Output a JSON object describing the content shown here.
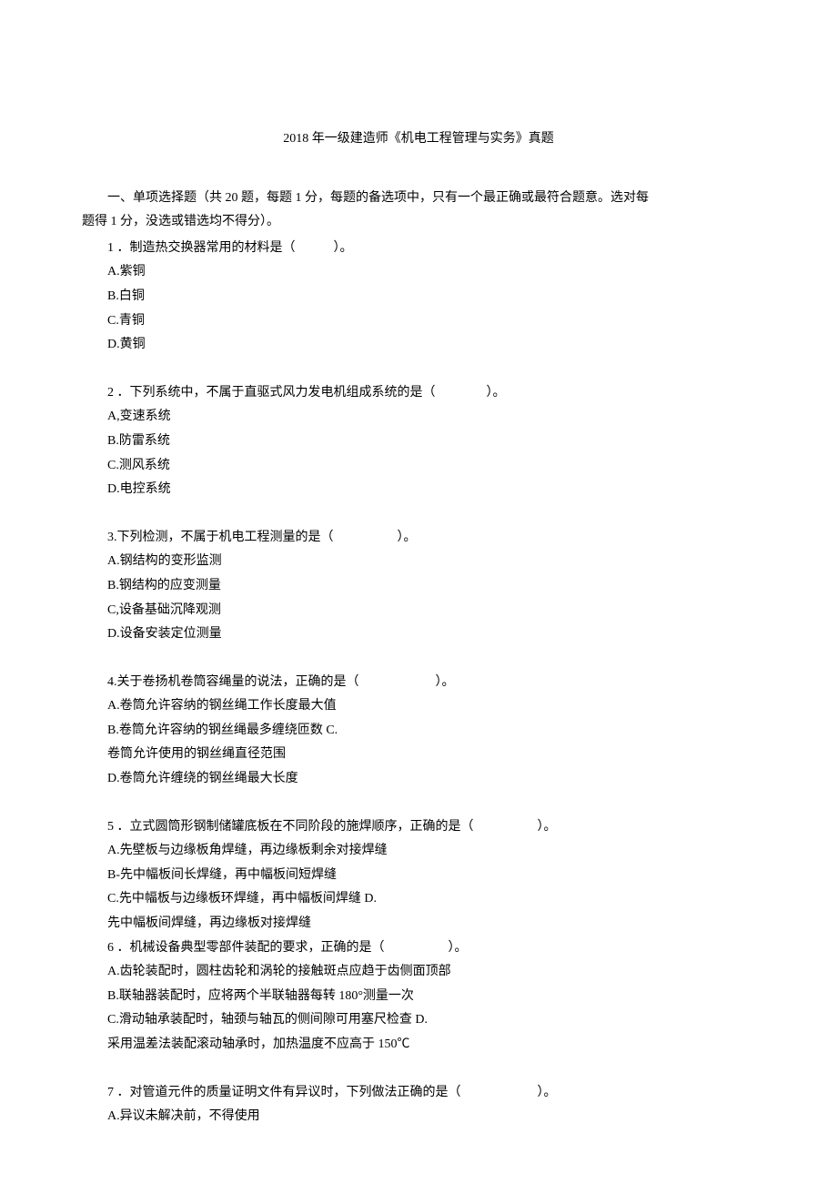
{
  "title": "2018 年一级建造师《机电工程管理与实务》真题",
  "section_header_line1": "一、单项选择题（共 20 题，每题 1 分，每题的备选项中，只有一个最正确或最符合题意。选对每",
  "section_header_line2": "题得 1 分，没选或错选均不得分）。",
  "q1": {
    "text": "1 ．制造热交换器常用的材料是（　　　）。",
    "a": "A.紫铜",
    "b": "B.白铜",
    "c": "C.青铜",
    "d": "D.黄铜"
  },
  "q2": {
    "text": "2 ．下列系统中，不属于直驱式风力发电机组成系统的是（　　　　）。",
    "a": "A,变速系统",
    "b": "B.防雷系统",
    "c": "C.测风系统",
    "d": "D.电控系统"
  },
  "q3": {
    "text": "3.下列检测，不属于机电工程测量的是（　　　　　）。",
    "a": "A.钢结构的变形监测",
    "b": "B.钢结构的应变测量",
    "c": "C,设备基础沉降观测",
    "d": "D.设备安装定位测量"
  },
  "q4": {
    "text": "4.关于卷扬机卷筒容绳量的说法，正确的是（　　　　　　）。",
    "a": "A.卷筒允许容纳的钢丝绳工作长度最大值",
    "b": "B.卷筒允许容纳的钢丝绳最多缠绕匝数 C.",
    "c": "卷筒允许使用的钢丝绳直径范围",
    "d": "D.卷筒允许缠绕的钢丝绳最大长度"
  },
  "q5": {
    "text": "5 ．立式圆筒形钢制储罐底板在不同阶段的施焊顺序，正确的是（　　　　　）。",
    "a": "A.先壁板与边缘板角焊缝，再边缘板剩余对接焊缝",
    "b": "B-先中幅板间长焊缝，再中幅板间短焊缝",
    "c": "C.先中幅板与边缘板环焊缝，再中幅板间焊缝 D.",
    "d": "先中幅板间焊缝，再边缘板对接焊缝"
  },
  "q6": {
    "text": "6 ．机械设备典型零部件装配的要求，正确的是（　　　　　）。",
    "a": "A.齿轮装配时，圆柱齿轮和涡轮的接触斑点应趋于齿侧面顶部",
    "b": "B.联轴器装配时，应将两个半联轴器每转 180°测量一次",
    "c": "C.滑动轴承装配时，轴颈与轴瓦的侧间隙可用塞尺检查 D.",
    "d": "采用温差法装配滚动轴承时，加热温度不应高于 150℃"
  },
  "q7": {
    "text": "7 ．对管道元件的质量证明文件有异议时，下列做法正确的是（　　　　　　）。",
    "a": "A.异议未解决前，不得使用"
  }
}
